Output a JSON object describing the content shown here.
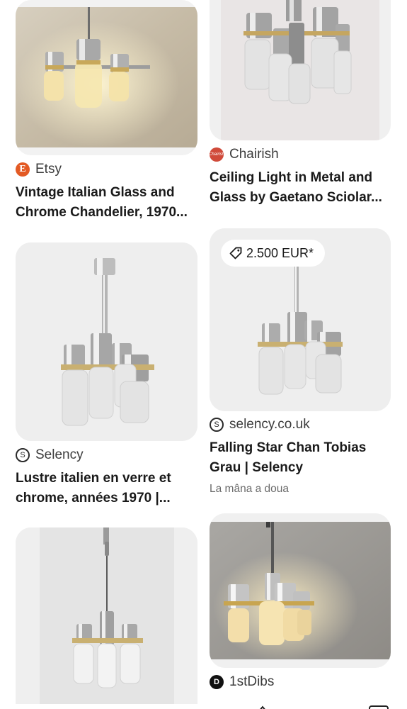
{
  "pins": [
    {
      "source": {
        "name": "Etsy",
        "icon": "etsy-favicon",
        "icon_letter": "E"
      },
      "title_lines": [
        "Vintage Italian Glass and",
        "Chrome Chandelier, 1970..."
      ]
    },
    {
      "source": {
        "name": "Chairish",
        "icon": "chairish-favicon",
        "icon_letter": "Chairish"
      },
      "title_lines": [
        "Ceiling Light in Metal and",
        "Glass by Gaetano Sciolar..."
      ]
    },
    {
      "source": {
        "name": "Selency",
        "icon": "selency-favicon",
        "icon_letter": "S"
      },
      "title_lines": [
        "Lustre italien en verre et",
        "chrome, années 1970 |..."
      ]
    },
    {
      "price": "2.500 EUR*",
      "source": {
        "name": "selency.co.uk",
        "icon": "selency-favicon",
        "icon_letter": "S"
      },
      "title_lines": [
        "Falling Star Chan Tobias",
        "Grau | Selency"
      ],
      "subtitle": "La mâna a doua"
    },
    {
      "source": null
    },
    {
      "source": {
        "name": "1stDibs",
        "icon": "1stdibs-favicon",
        "icon_letter": "D"
      }
    }
  ],
  "colors": {
    "etsy": "#e35a24",
    "chairish": "#d04a3a",
    "card_gray": "#eeeeee"
  }
}
